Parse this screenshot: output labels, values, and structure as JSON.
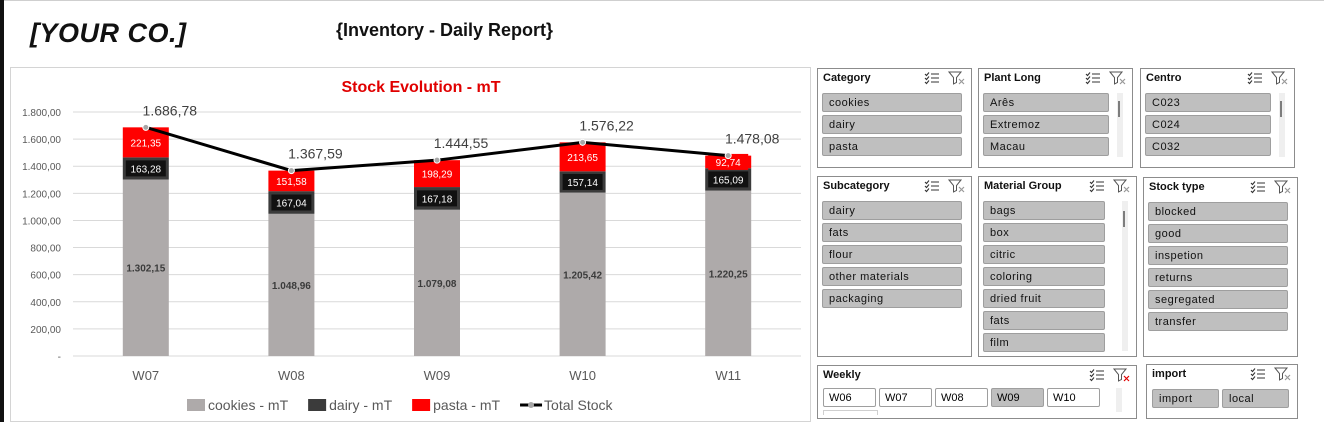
{
  "header": {
    "company": "[YOUR CO.]",
    "report_title": "{Inventory - Daily Report}"
  },
  "chart_data": {
    "type": "bar",
    "stacked": true,
    "title": "Stock Evolution - mT",
    "categories": [
      "W07",
      "W08",
      "W09",
      "W10",
      "W11"
    ],
    "ylim": [
      0,
      1800
    ],
    "yticks": [
      "-",
      "200,00",
      "400,00",
      "600,00",
      "800,00",
      "1.000,00",
      "1.200,00",
      "1.400,00",
      "1.600,00",
      "1.800,00"
    ],
    "grid": true,
    "legend_position": "bottom",
    "series": [
      {
        "name": "cookies - mT",
        "values": [
          1302.15,
          1048.96,
          1079.08,
          1205.42,
          1220.25
        ],
        "labels": [
          "1.302,15",
          "1.048,96",
          "1.079,08",
          "1.205,42",
          "1.220,25"
        ],
        "color": "#aeaaaa",
        "label_color": "#3b3b3b"
      },
      {
        "name": "dairy - mT",
        "values": [
          163.28,
          167.04,
          167.18,
          157.14,
          165.09
        ],
        "labels": [
          "163,28",
          "167,04",
          "167,18",
          "157,14",
          "165,09"
        ],
        "color": "#3b3b3b",
        "label_color": "#ffffff"
      },
      {
        "name": "pasta - mT",
        "values": [
          221.35,
          151.58,
          198.29,
          213.65,
          92.74
        ],
        "labels": [
          "221,35",
          "151,58",
          "198,29",
          "213,65",
          "92,74"
        ],
        "color": "#ff0000",
        "label_color": "#ffffff"
      }
    ],
    "line_series": {
      "name": "Total Stock",
      "values": [
        1686.78,
        1367.59,
        1444.55,
        1576.22,
        1478.08
      ],
      "labels": [
        "1.686,78",
        "1.367,59",
        "1.444,55",
        "1.576,22",
        "1.478,08"
      ],
      "color": "#000000"
    },
    "title_color": "#e00000"
  },
  "slicers": {
    "category": {
      "title": "Category",
      "items": [
        "cookies",
        "dairy",
        "pasta"
      ]
    },
    "plant_long": {
      "title": "Plant Long",
      "items": [
        "Arês",
        "Extremoz",
        "Macau"
      ]
    },
    "centro": {
      "title": "Centro",
      "items": [
        "C023",
        "C024",
        "C032"
      ]
    },
    "subcategory": {
      "title": "Subcategory",
      "items": [
        "dairy",
        "fats",
        "flour",
        "other materials",
        "packaging"
      ]
    },
    "material_group": {
      "title": "Material Group",
      "items": [
        "bags",
        "box",
        "citric",
        "coloring",
        "dried fruit",
        "fats",
        "film"
      ]
    },
    "stock_type": {
      "title": "Stock type",
      "items": [
        "blocked",
        "good",
        "inspetion",
        "returns",
        "segregated",
        "transfer"
      ]
    },
    "weekly": {
      "title": "Weekly",
      "items": [
        "W06",
        "W07",
        "W08",
        "W09",
        "W10"
      ],
      "selected": "W09"
    },
    "import": {
      "title": "import",
      "items": [
        "import",
        "local"
      ]
    }
  },
  "icons": [
    "multi-select-icon",
    "clear-filter-icon"
  ]
}
